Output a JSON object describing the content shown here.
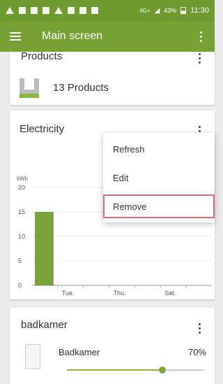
{
  "status_bar": {
    "network": "4G+",
    "battery": "43%",
    "time": "11:30"
  },
  "app_bar": {
    "title": "Main screen"
  },
  "cards": {
    "products": {
      "title": "Products",
      "count_label": "13 Products"
    },
    "electricity": {
      "title": "Electricity"
    },
    "badkamer": {
      "title": "badkamer",
      "device_name": "Badkamer",
      "level_text": "70%",
      "level": 0.7
    }
  },
  "context_menu": {
    "items": [
      "Refresh",
      "Edit",
      "Remove"
    ],
    "selected": "Remove"
  },
  "colors": {
    "app_green": "#77a133",
    "status_green": "#6e9a2f",
    "bar_green": "#7aa23a",
    "highlight": "#e06b78"
  },
  "chart_data": {
    "type": "bar",
    "ylabel": "kWh",
    "ylim": [
      0,
      20
    ],
    "yticks": [
      "0",
      "5",
      "10",
      "15",
      "20"
    ],
    "xtick_labels": [
      "Tue.",
      "Thu.",
      "Sat."
    ],
    "bars": [
      {
        "x_index": 0,
        "value": 15
      }
    ]
  }
}
